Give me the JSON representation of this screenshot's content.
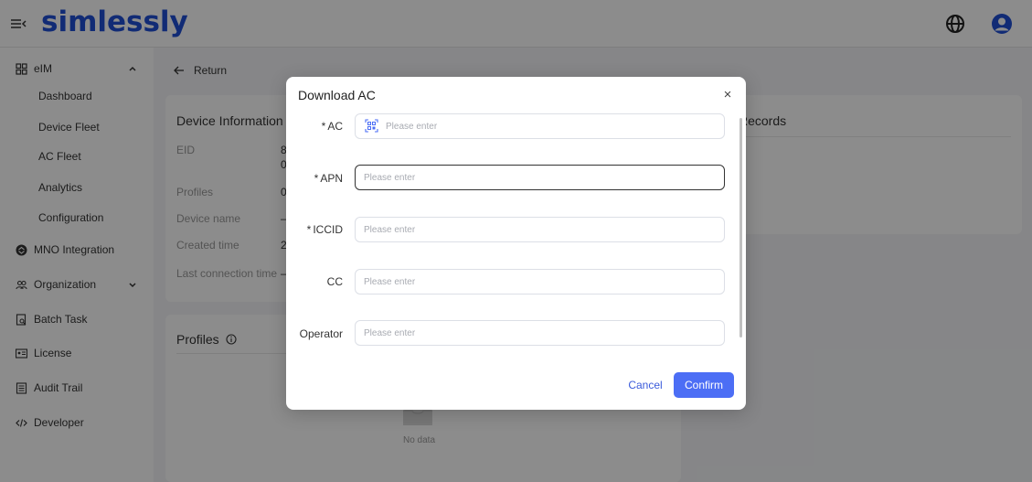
{
  "header": {
    "logo": "simlessly",
    "menu_icon": "menu-collapse-icon",
    "globe_icon": "globe-icon",
    "user_icon": "user-icon",
    "brand_color": "#1f4fd6"
  },
  "sidebar": {
    "group_elm": {
      "label": "eIM",
      "icon": "grid-icon"
    },
    "sub_items": [
      "Dashboard",
      "Device Fleet",
      "AC Fleet",
      "Analytics",
      "Configuration"
    ],
    "items": [
      {
        "label": "MNO Integration",
        "icon": "mno-icon"
      },
      {
        "label": "Organization",
        "icon": "people-icon"
      },
      {
        "label": "Batch Task",
        "icon": "batch-icon"
      },
      {
        "label": "License",
        "icon": "license-icon"
      },
      {
        "label": "Audit Trail",
        "icon": "audit-icon"
      },
      {
        "label": "Developer",
        "icon": "code-icon"
      }
    ]
  },
  "main": {
    "return_label": "Return",
    "device_info": {
      "title": "Device Information",
      "rows": [
        {
          "label": "EID",
          "value": "8"
        },
        {
          "label": "",
          "value": "0"
        },
        {
          "label": "Profiles",
          "value": "0"
        },
        {
          "label": "Device name",
          "value": "–"
        },
        {
          "label": "Created time",
          "value": "2"
        },
        {
          "label": "Last connection time",
          "value": "–"
        }
      ]
    },
    "records_title": "Records",
    "profiles_title": "Profiles",
    "no_data": "No data"
  },
  "modal": {
    "title": "Download AC",
    "close": "×",
    "fields": [
      {
        "label": "AC",
        "required": true,
        "placeholder": "Please enter",
        "value": ""
      },
      {
        "label": "APN",
        "required": true,
        "placeholder": "Please enter",
        "value": ""
      },
      {
        "label": "ICCID",
        "required": true,
        "placeholder": "Please enter",
        "value": ""
      },
      {
        "label": "CC",
        "required": false,
        "placeholder": "Please enter",
        "value": ""
      },
      {
        "label": "Operator",
        "required": false,
        "placeholder": "Please enter",
        "value": ""
      }
    ],
    "cancel": "Cancel",
    "confirm": "Confirm",
    "accent_color": "#4c6ef5"
  }
}
